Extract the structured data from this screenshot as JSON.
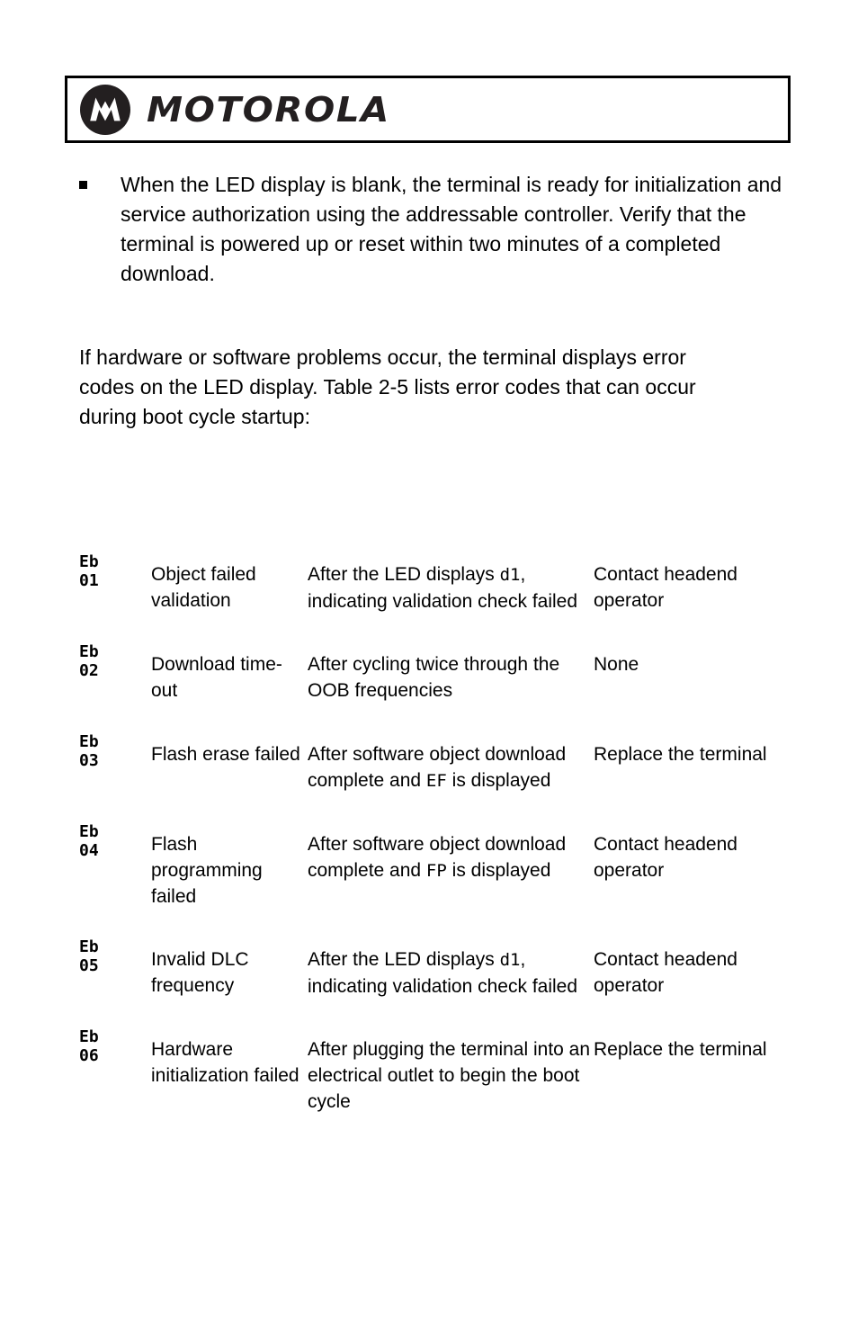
{
  "header": {
    "logo_icon": "motorola-batwing-icon",
    "wordmark": "MOTOROLA"
  },
  "bullets": [
    {
      "marker": "square-bullet-icon",
      "text": "When the LED display is blank, the terminal is ready for initialization and service authorization using the addressable controller. Verify that the terminal is powered up or reset within two minutes of a completed download."
    }
  ],
  "intro_paragraph": "If hardware or software problems occur, the terminal displays error codes on the LED display. Table 2-5 lists error codes that can occur during boot cycle startup:",
  "table": {
    "caption_reference": "Table 2-5",
    "rows": [
      {
        "code": "Eb\n01",
        "description": "Object failed validation",
        "when_pre": "After the LED displays ",
        "when_mono": "d1",
        "when_post": ", indicating validation check failed",
        "action": "Contact headend operator"
      },
      {
        "code": "Eb\n02",
        "description": "Download time-out",
        "when_pre": "After cycling twice through the OOB frequencies",
        "when_mono": "",
        "when_post": "",
        "action": "None"
      },
      {
        "code": "Eb\n03",
        "description": "Flash erase failed",
        "when_pre": "After software object download complete and  ",
        "when_mono": "EF",
        "when_post": " is displayed",
        "action": "Replace the terminal"
      },
      {
        "code": "Eb\n04",
        "description": "Flash programming failed",
        "when_pre": "After software object download complete and ",
        "when_mono": "FP",
        "when_post": " is displayed",
        "action": "Contact headend operator"
      },
      {
        "code": "Eb\n05",
        "description": "Invalid DLC frequency",
        "when_pre": "After the LED displays ",
        "when_mono": "d1",
        "when_post": ", indicating validation check failed",
        "action": "Contact headend operator"
      },
      {
        "code": "Eb\n06",
        "description": "Hardware initialization failed",
        "when_pre": "After plugging the terminal into an electrical outlet to begin the boot cycle",
        "when_mono": "",
        "when_post": "",
        "action": "Replace the terminal"
      }
    ]
  },
  "colors": {
    "text": "#000000",
    "wordmark": "#231f20",
    "border": "#000000",
    "page_background": "#ffffff"
  }
}
